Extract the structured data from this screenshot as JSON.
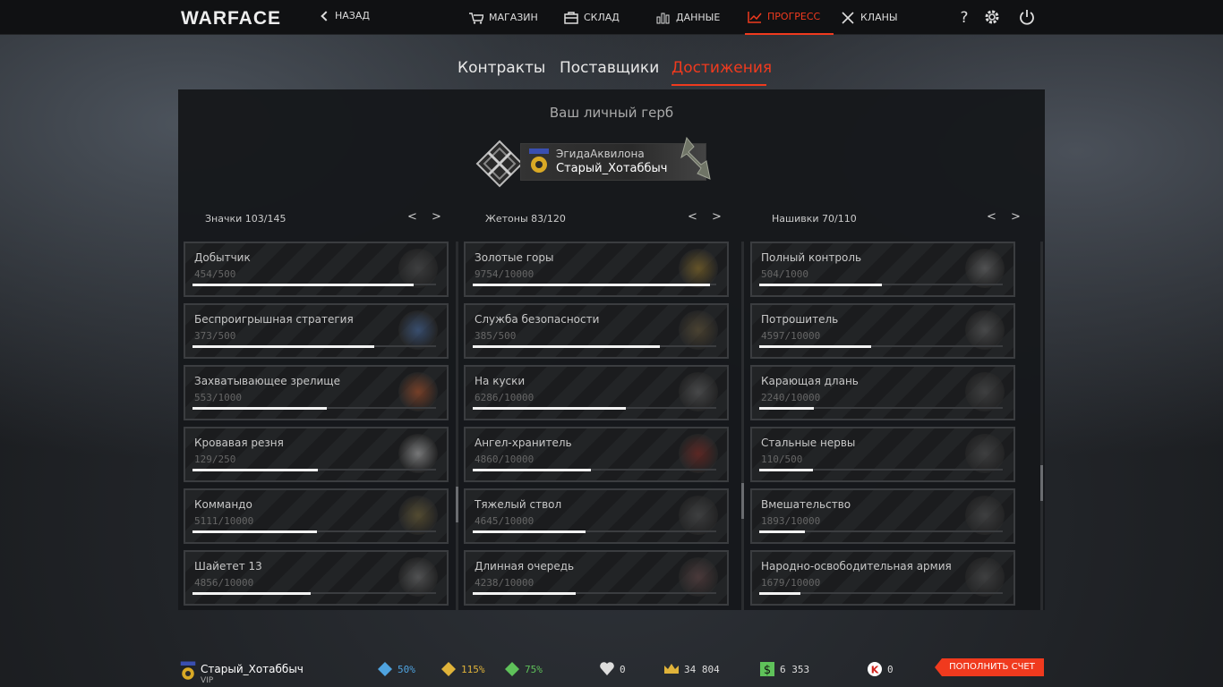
{
  "topbar": {
    "logo": "WARFACE",
    "back_label": "НАЗАД",
    "nav": [
      {
        "label": "МАГАЗИН",
        "icon": "cart-icon"
      },
      {
        "label": "СКЛАД",
        "icon": "storage-icon"
      },
      {
        "label": "ДАННЫЕ",
        "icon": "stats-icon"
      },
      {
        "label": "ПРОГРЕСС",
        "icon": "progress-icon",
        "active": true
      },
      {
        "label": "КЛАНЫ",
        "icon": "clans-icon"
      }
    ],
    "help_label": "?"
  },
  "tabs": [
    "Контракты",
    "Поставщики",
    "Достижения"
  ],
  "active_tab": "Достижения",
  "crest": {
    "title": "Ваш личный герб",
    "clan": "ЭгидаАквилона",
    "nick": "Старый_Хотаббыч"
  },
  "columns": [
    {
      "title": "Значки 103/145",
      "arrows": "< >",
      "items": [
        {
          "name": "Добытчик",
          "progress": "454/500",
          "fraction": 0.908
        },
        {
          "name": "Беспроигрышная стратегия",
          "progress": "373/500",
          "fraction": 0.746
        },
        {
          "name": "Захватывающее зрелище",
          "progress": "553/1000",
          "fraction": 0.553
        },
        {
          "name": "Кровавая резня",
          "progress": "129/250",
          "fraction": 0.516
        },
        {
          "name": "Коммандо",
          "progress": "5111/10000",
          "fraction": 0.511
        },
        {
          "name": "Шайетет 13",
          "progress": "4856/10000",
          "fraction": 0.486
        }
      ]
    },
    {
      "title": "Жетоны 83/120",
      "arrows": "< >",
      "items": [
        {
          "name": "Золотые горы",
          "progress": "9754/10000",
          "fraction": 0.975
        },
        {
          "name": "Служба безопасности",
          "progress": "385/500",
          "fraction": 0.77
        },
        {
          "name": "На куски",
          "progress": "6286/10000",
          "fraction": 0.629
        },
        {
          "name": "Ангел-хранитель",
          "progress": "4860/10000",
          "fraction": 0.486
        },
        {
          "name": "Тяжелый ствол",
          "progress": "4645/10000",
          "fraction": 0.465
        },
        {
          "name": "Длинная очередь",
          "progress": "4238/10000",
          "fraction": 0.424
        }
      ]
    },
    {
      "title": "Нашивки 70/110",
      "arrows": "< >",
      "items": [
        {
          "name": "Полный контроль",
          "progress": "504/1000",
          "fraction": 0.504
        },
        {
          "name": "Потрошитель",
          "progress": "4597/10000",
          "fraction": 0.46
        },
        {
          "name": "Карающая длань",
          "progress": "2240/10000",
          "fraction": 0.224
        },
        {
          "name": "Стальные нервы",
          "progress": "110/500",
          "fraction": 0.22
        },
        {
          "name": "Вмешательство",
          "progress": "1893/10000",
          "fraction": 0.189
        },
        {
          "name": "Народно-освободительная армия",
          "progress": "1679/10000",
          "fraction": 0.168
        }
      ]
    }
  ],
  "footer": {
    "nick": "Старый_Хотаббыч",
    "vip": "VIP",
    "boost_blue": "50%",
    "boost_gold": "115%",
    "boost_green": "75%",
    "hearts": "0",
    "crowns": "34 804",
    "money": "6 353",
    "kredits": "0",
    "topup_label": "ПОПОЛНИТЬ СЧЕТ"
  },
  "colors": {
    "accent": "#f03a1e",
    "bar": "#f2f2f2"
  }
}
